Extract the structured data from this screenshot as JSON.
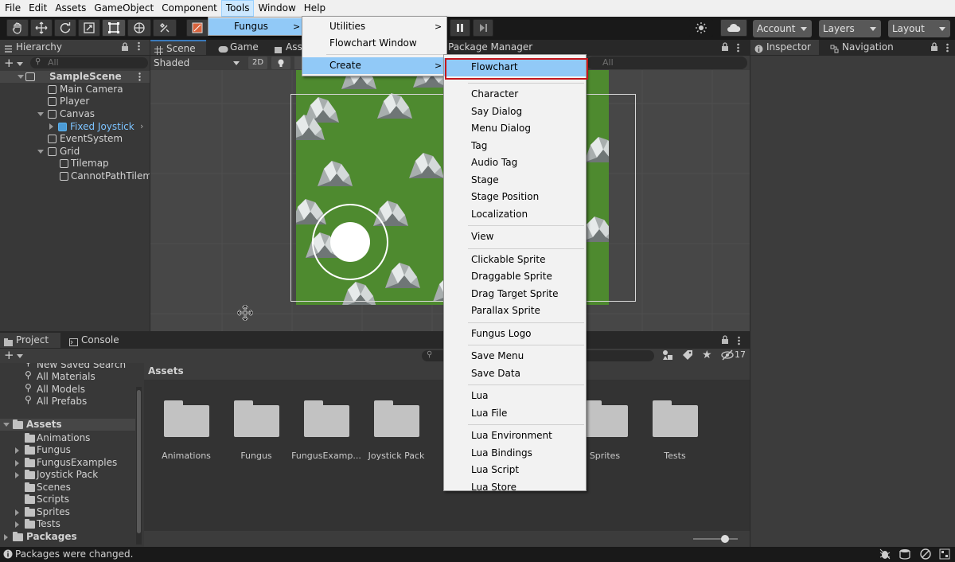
{
  "menubar": [
    "File",
    "Edit",
    "Assets",
    "GameObject",
    "Component",
    "Tools",
    "Window",
    "Help"
  ],
  "toolbar": {
    "account": "Account",
    "layers": "Layers",
    "layout": "Layout"
  },
  "hierarchy": {
    "tab": "Hierarchy",
    "search_placeholder": "All",
    "scene": "SampleScene",
    "items": [
      "Main Camera",
      "Player",
      "Canvas",
      "Fixed Joystick",
      "EventSystem",
      "Grid",
      "Tilemap",
      "CannotPathTilemap"
    ]
  },
  "scene": {
    "tabs": [
      "Scene",
      "Game",
      "Asset Store",
      "Package Manager"
    ],
    "shading": "Shaded",
    "mode_2d": "2D"
  },
  "inspector": {
    "tabs": [
      "Inspector",
      "Navigation"
    ]
  },
  "project": {
    "tabs": [
      "Project",
      "Console"
    ],
    "favorites": [
      "New Saved Search",
      "All Materials",
      "All Models",
      "All Prefabs"
    ],
    "assets_root": "Assets",
    "asset_children": [
      "Animations",
      "Fungus",
      "FungusExamples",
      "Joystick Pack",
      "Scenes",
      "Scripts",
      "Sprites",
      "Tests"
    ],
    "packages": "Packages",
    "breadcrumb": "Assets",
    "folders": [
      "Animations",
      "Fungus",
      "FungusExamp...",
      "Joystick Pack",
      "Sprites",
      "Tests"
    ],
    "hidden_count": "17"
  },
  "status": {
    "message": "Packages were changed."
  },
  "menus": {
    "tools": [
      {
        "label": "Fungus"
      }
    ],
    "fungus": [
      "Utilities",
      "Flowchart Window",
      "Create"
    ],
    "create": {
      "groups": [
        [
          "Flowchart"
        ],
        [
          "Character",
          "Say Dialog",
          "Menu Dialog",
          "Tag",
          "Audio Tag",
          "Stage",
          "Stage Position",
          "Localization"
        ],
        [
          "View"
        ],
        [
          "Clickable Sprite",
          "Draggable Sprite",
          "Drag Target Sprite",
          "Parallax Sprite"
        ],
        [
          "Fungus Logo"
        ],
        [
          "Save Menu",
          "Save Data"
        ],
        [
          "Lua",
          "Lua File"
        ],
        [
          "Lua Environment",
          "Lua Bindings",
          "Lua Script",
          "Lua Store"
        ]
      ]
    }
  },
  "colors": {
    "highlight": "#91c9f7",
    "outline": "#c4161c",
    "selection": "#2c5d87",
    "accent": "#3a79bb"
  }
}
